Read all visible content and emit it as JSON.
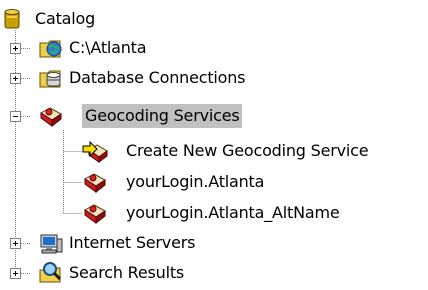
{
  "tree": {
    "root": {
      "label": "Catalog",
      "icon": "catalog-icon"
    },
    "items": [
      {
        "label": "C:\\Atlanta",
        "icon": "folder-globe-icon",
        "expander": "plus"
      },
      {
        "label": "Database Connections",
        "icon": "database-connections-icon",
        "expander": "plus"
      },
      {
        "label": "Geocoding Services",
        "icon": "geocoding-services-icon",
        "expander": "minus",
        "selected": true,
        "children": [
          {
            "label": "Create New Geocoding Service",
            "icon": "create-new-geocoding-service-icon"
          },
          {
            "label": "yourLogin.Atlanta",
            "icon": "geocoding-service-icon"
          },
          {
            "label": "yourLogin.Atlanta_AltName",
            "icon": "geocoding-service-icon"
          }
        ]
      },
      {
        "label": "Internet Servers",
        "icon": "internet-servers-icon",
        "expander": "plus"
      },
      {
        "label": "Search Results",
        "icon": "search-results-icon",
        "expander": "plus"
      }
    ]
  },
  "colors": {
    "selection": "#c0c0c0",
    "tree_lines": "#808080",
    "expander_border": "#808080"
  }
}
